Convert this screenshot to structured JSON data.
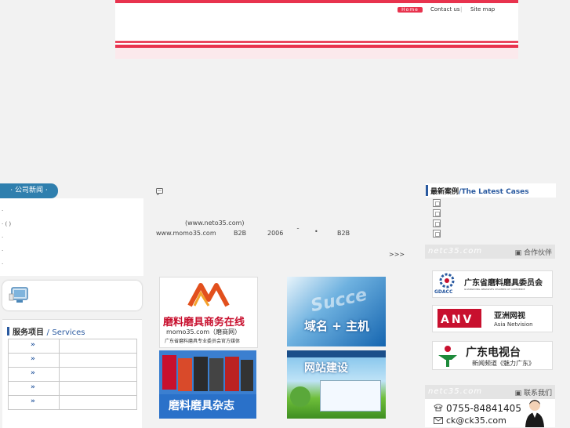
{
  "header": {
    "home_label": "Home",
    "contact_label": "Contact us",
    "sitemap_label": "Site map"
  },
  "left": {
    "news_title": "· 公司新闻 ·",
    "news_items": [
      "·",
      "·  ( )",
      "·",
      "·",
      "·"
    ],
    "services_title_cn": "服务项目",
    "services_sep": "/",
    "services_title_en": "Services",
    "service_arrows": [
      "»",
      "»",
      "»",
      "»",
      "»"
    ]
  },
  "middle": {
    "quote_icon": "speech-icon",
    "url_line": "(www.neto35.com)",
    "line2_site": "www.momo35.com",
    "line2_b2b": "B2B",
    "line2_year": "2006",
    "line2_dash": "ˉ",
    "line2_dot": "•",
    "line2_b2b2": "B2B",
    "more": ">>>",
    "tiles": {
      "momo_title": "磨料磨具商务在线",
      "momo_url": "momo35.com（磨商网）",
      "momo_sub": "广东省磨料磨具专业委员会官方媒体",
      "domain_title": "域名 + 主机",
      "magazine_title": "磨料磨具杂志",
      "website_title": "网站建设"
    }
  },
  "right": {
    "cases_title_cn": "最新案例",
    "cases_sep": "/",
    "cases_title_en": "The Latest Cases",
    "partners_logo": "netc35.com",
    "partners_label": "合作伙伴",
    "partners": [
      {
        "logo": "GDACC",
        "name": "广东省磨料磨具委员会",
        "sub": "GUANGDONG ABRASIVES CHAMBER OF COMMERCE"
      },
      {
        "logo": "ANV",
        "name": "亚洲网视",
        "sub": "Asia Netvision"
      },
      {
        "logo": "",
        "name": "广东电视台",
        "sub": "新闻频道《魅力广东》"
      }
    ],
    "contact_logo": "netc35.com",
    "contact_label": "联系我们",
    "phone": "0755-84841405",
    "email": "ck@ck35.com"
  },
  "colors": {
    "brand_red": "#e8334e",
    "blue": "#2a5aa0",
    "news_tab": "#2f7fae"
  }
}
